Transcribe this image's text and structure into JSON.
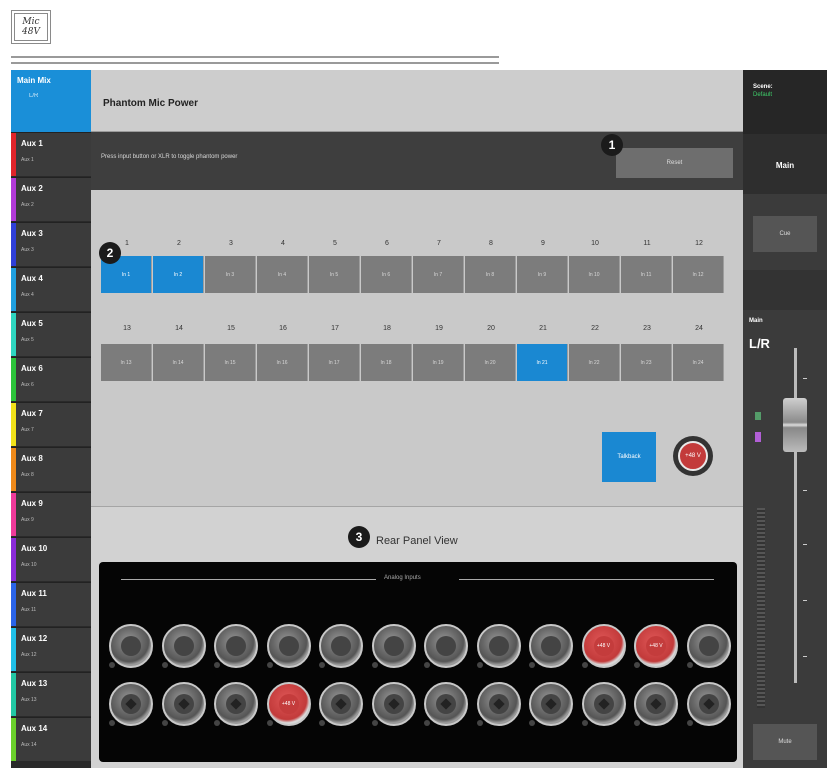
{
  "icon_box": {
    "line1": "Mic",
    "line2": "48V"
  },
  "sidebar": {
    "main_mix": {
      "label": "Main Mix",
      "sub": "L/R"
    },
    "aux": [
      {
        "label": "Aux 1",
        "sub": "Aux 1",
        "color": "#e0242a"
      },
      {
        "label": "Aux 2",
        "sub": "Aux 2",
        "color": "#b23ad8"
      },
      {
        "label": "Aux 3",
        "sub": "Aux 3",
        "color": "#2f3fd8"
      },
      {
        "label": "Aux 4",
        "sub": "Aux 4",
        "color": "#20a0e0"
      },
      {
        "label": "Aux 5",
        "sub": "Aux 5",
        "color": "#2ed6c0"
      },
      {
        "label": "Aux 6",
        "sub": "Aux 6",
        "color": "#2cc43a"
      },
      {
        "label": "Aux 7",
        "sub": "Aux 7",
        "color": "#f2e21a"
      },
      {
        "label": "Aux 8",
        "sub": "Aux 8",
        "color": "#f08a1a"
      },
      {
        "label": "Aux 9",
        "sub": "Aux 9",
        "color": "#ef3a9a"
      },
      {
        "label": "Aux 10",
        "sub": "Aux 10",
        "color": "#8a2ad8"
      },
      {
        "label": "Aux 11",
        "sub": "Aux 11",
        "color": "#2a64e8"
      },
      {
        "label": "Aux 12",
        "sub": "Aux 12",
        "color": "#20c0e8"
      },
      {
        "label": "Aux 13",
        "sub": "Aux 13",
        "color": "#22c8a4"
      },
      {
        "label": "Aux 14",
        "sub": "Aux 14",
        "color": "#6ad02a"
      }
    ]
  },
  "panel": {
    "title": "Phantom Mic Power",
    "instruction": "Press input button or XLR to toggle phantom power",
    "reset_label": "Reset",
    "row1_numbers": [
      "1",
      "2",
      "3",
      "4",
      "5",
      "6",
      "7",
      "8",
      "9",
      "10",
      "11",
      "12"
    ],
    "row1_channels": [
      "In 1",
      "In 2",
      "In 3",
      "In 4",
      "In 5",
      "In 6",
      "In 7",
      "In 8",
      "In 9",
      "In 10",
      "In 11",
      "In 12"
    ],
    "row2_numbers": [
      "13",
      "14",
      "15",
      "16",
      "17",
      "18",
      "19",
      "20",
      "21",
      "22",
      "23",
      "24"
    ],
    "row2_channels": [
      "In 13",
      "In 14",
      "In 15",
      "In 16",
      "In 17",
      "In 18",
      "In 19",
      "In 20",
      "In 21",
      "In 22",
      "In 23",
      "In 24"
    ],
    "active_channels": [
      1,
      2,
      21
    ],
    "talkback_label": "Talkback",
    "talkback_p48_label": "+48 V",
    "rear_title": "Rear Panel View",
    "analog_inputs_label": "Analog Inputs",
    "xlr_label": "+48 V",
    "xlr_row1_red": [
      10,
      11
    ],
    "xlr_row2_red": [
      4
    ]
  },
  "callouts": [
    "1",
    "2",
    "3"
  ],
  "right": {
    "scene_label": "Scene:",
    "scene_value": "Default",
    "main_label": "Main",
    "cue_label": "Cue",
    "fader_title": "Main",
    "fader_name": "L/R",
    "mute_label": "Mute"
  }
}
